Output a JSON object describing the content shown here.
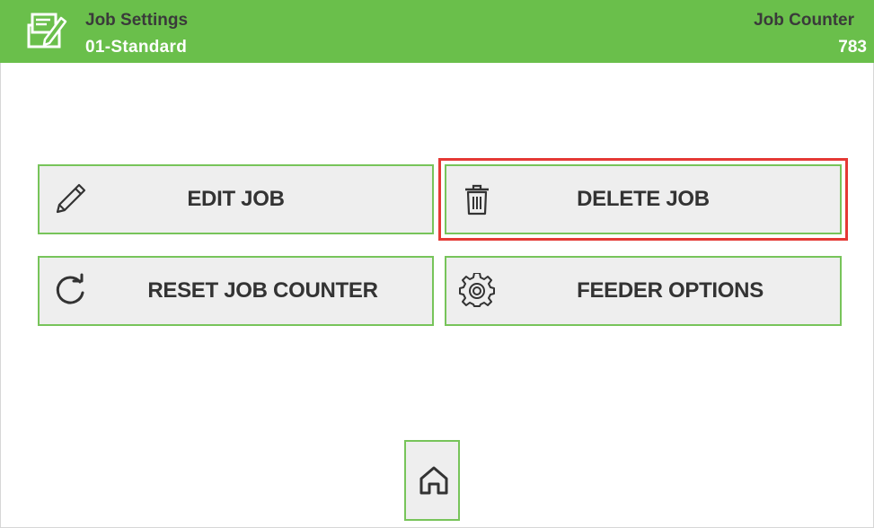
{
  "header": {
    "title": "Job Settings",
    "job_name": "01-Standard",
    "counter_label": "Job Counter",
    "counter_value": "783",
    "icon": "job-settings-icon",
    "background": "#6abf4b"
  },
  "buttons": {
    "edit": {
      "label": "EDIT JOB",
      "icon": "pencil-icon"
    },
    "delete": {
      "label": "DELETE JOB",
      "icon": "trash-icon"
    },
    "reset": {
      "label": "RESET JOB COUNTER",
      "icon": "refresh-icon"
    },
    "feeder": {
      "label": "FEEDER OPTIONS",
      "icon": "gear-icon"
    }
  },
  "home": {
    "icon": "home-icon"
  },
  "colors": {
    "accent_green": "#77c45a",
    "button_bg": "#eeeeee",
    "highlight": "#e53935"
  }
}
